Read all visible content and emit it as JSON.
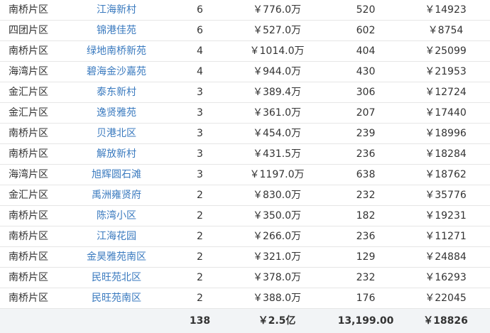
{
  "table": {
    "rows": [
      {
        "district": "南桥片区",
        "community": "江海新村",
        "count": "6",
        "total_price": "￥776.0万",
        "area": "520",
        "unit_price": "￥14923"
      },
      {
        "district": "四团片区",
        "community": "锦港佳苑",
        "count": "6",
        "total_price": "￥527.0万",
        "area": "602",
        "unit_price": "￥8754"
      },
      {
        "district": "南桥片区",
        "community": "绿地南桥新苑",
        "count": "4",
        "total_price": "￥1014.0万",
        "area": "404",
        "unit_price": "￥25099"
      },
      {
        "district": "海湾片区",
        "community": "碧海金沙嘉苑",
        "count": "4",
        "total_price": "￥944.0万",
        "area": "430",
        "unit_price": "￥21953"
      },
      {
        "district": "金汇片区",
        "community": "泰东新村",
        "count": "3",
        "total_price": "￥389.4万",
        "area": "306",
        "unit_price": "￥12724"
      },
      {
        "district": "金汇片区",
        "community": "逸贤雅苑",
        "count": "3",
        "total_price": "￥361.0万",
        "area": "207",
        "unit_price": "￥17440"
      },
      {
        "district": "南桥片区",
        "community": "贝港北区",
        "count": "3",
        "total_price": "￥454.0万",
        "area": "239",
        "unit_price": "￥18996"
      },
      {
        "district": "南桥片区",
        "community": "解放新村",
        "count": "3",
        "total_price": "￥431.5万",
        "area": "236",
        "unit_price": "￥18284"
      },
      {
        "district": "海湾片区",
        "community": "旭辉圆石滩",
        "count": "3",
        "total_price": "￥1197.0万",
        "area": "638",
        "unit_price": "￥18762"
      },
      {
        "district": "金汇片区",
        "community": "禹洲雍贤府",
        "count": "2",
        "total_price": "￥830.0万",
        "area": "232",
        "unit_price": "￥35776"
      },
      {
        "district": "南桥片区",
        "community": "陈湾小区",
        "count": "2",
        "total_price": "￥350.0万",
        "area": "182",
        "unit_price": "￥19231"
      },
      {
        "district": "南桥片区",
        "community": "江海花园",
        "count": "2",
        "total_price": "￥266.0万",
        "area": "236",
        "unit_price": "￥11271"
      },
      {
        "district": "南桥片区",
        "community": "金昊雅苑南区",
        "count": "2",
        "total_price": "￥321.0万",
        "area": "129",
        "unit_price": "￥24884"
      },
      {
        "district": "南桥片区",
        "community": "民旺苑北区",
        "count": "2",
        "total_price": "￥378.0万",
        "area": "232",
        "unit_price": "￥16293"
      },
      {
        "district": "南桥片区",
        "community": "民旺苑南区",
        "count": "2",
        "total_price": "￥388.0万",
        "area": "176",
        "unit_price": "￥22045"
      }
    ],
    "totals": {
      "district": "",
      "community": "",
      "count": "138",
      "total_price": "￥2.5亿",
      "area": "13,199.00",
      "unit_price": "￥18826"
    }
  }
}
